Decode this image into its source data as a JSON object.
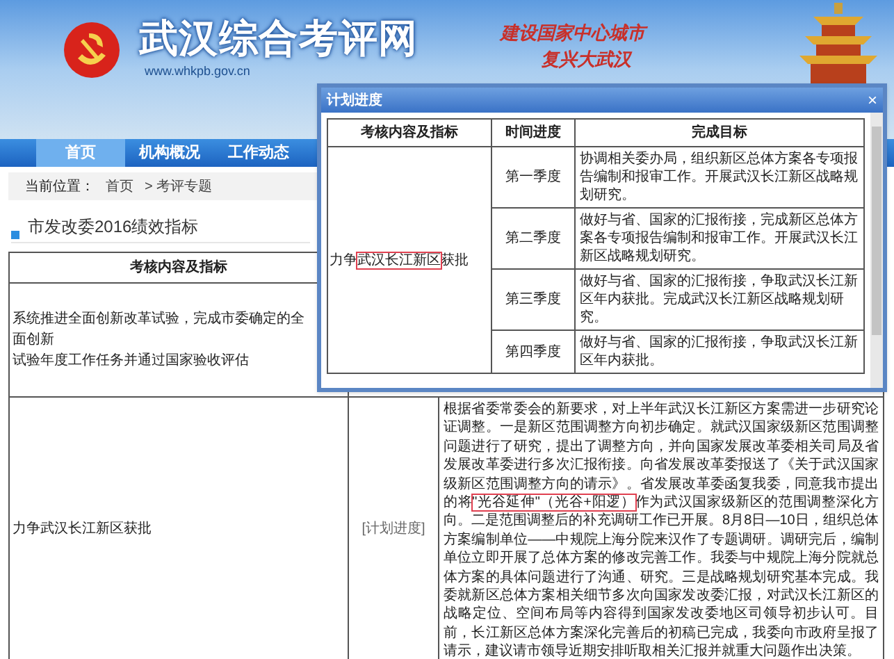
{
  "header": {
    "site_title": "武汉综合考评网",
    "url": "www.whkpb.gov.cn",
    "slogans": [
      "建设国家中心城市",
      "复兴大武汉"
    ]
  },
  "nav": [
    {
      "label": "首页",
      "selected": true
    },
    {
      "label": "机构概况",
      "selected": false
    },
    {
      "label": "工作动态",
      "selected": false
    }
  ],
  "breadcrumb": {
    "label": "当前位置：",
    "items": [
      "首页",
      "> 考评专题"
    ]
  },
  "section_title": "市发改委2016绩效指标",
  "table": {
    "columns": [
      "考核内容及指标"
    ],
    "rows": [
      {
        "lines": [
          "系统推进全面创新改革试验，完成市委确定的全面创新",
          "试验年度工作任务并通过国家验收评估"
        ]
      },
      {
        "indicator": "力争武汉长江新区获批",
        "progress": "[计划进度]",
        "parts": [
          {
            "text": "根据省委常委会的新要求，对上半年武汉长江新区方案需进一步研究论证调整。一是新区范围调整方向初步确定。就武汉国家级新区范围调整问题进行了研究，提出了调整方向，并向国家发展改革委相关司局及省发展改革委进行多次汇报衔接。向省发展改革委报送了《关于武汉国家级新区范围调整方向的请示》。省发展改革委函复我委，同意我市提出的将",
            "highlighted": false
          },
          {
            "text": "\"光谷延伸\"（光谷+阳逻）",
            "highlighted": true
          },
          {
            "text": "作为武汉国家级新区的范围调整深化方向。二是范围调整后的补充调研工作已开展。8月8日—10日，组织总体方案编制单位——中规院上海分院来汉作了专题调研。调研完后，编制单位立即开展了总体方案的修改完善工作。我委与中规院上海分院就总体方案的具体问题进行了沟通、研究。三是战略规划研究基本完成。我委就新区总体方案相关细节多次向国家发改委汇报，对武汉长江新区的战略定位、空间布局等内容得到国家发改委地区司领导初步认可。目前，长江新区总体方案深化完善后的初稿已完成，我委向市政府呈报了请示，建议请市领导近期安排听取相关汇报并就重大问题作出决策。",
            "highlighted": false
          }
        ]
      }
    ]
  },
  "dialog": {
    "title": "计划进度",
    "close": "×",
    "columns": [
      "考核内容及指标",
      "时间进度",
      "完成目标"
    ],
    "indicator_parts": [
      {
        "text": "力争",
        "highlighted": false
      },
      {
        "text": "武汉长江新区",
        "highlighted": true
      },
      {
        "text": "获批",
        "highlighted": false
      }
    ],
    "rows": [
      {
        "period": "第一季度",
        "goal": "协调相关委办局，组织新区总体方案各专项报告编制和报审工作。开展武汉长江新区战略规划研究。"
      },
      {
        "period": "第二季度",
        "goal": "做好与省、国家的汇报衔接，完成新区总体方案各专项报告编制和报审工作。开展武汉长江新区战略规划研究。"
      },
      {
        "period": "第三季度",
        "goal": "做好与省、国家的汇报衔接，争取武汉长江新区年内获批。完成武汉长江新区战略规划研究。"
      },
      {
        "period": "第四季度",
        "goal": "做好与省、国家的汇报衔接，争取武汉长江新区年内获批。"
      }
    ]
  }
}
